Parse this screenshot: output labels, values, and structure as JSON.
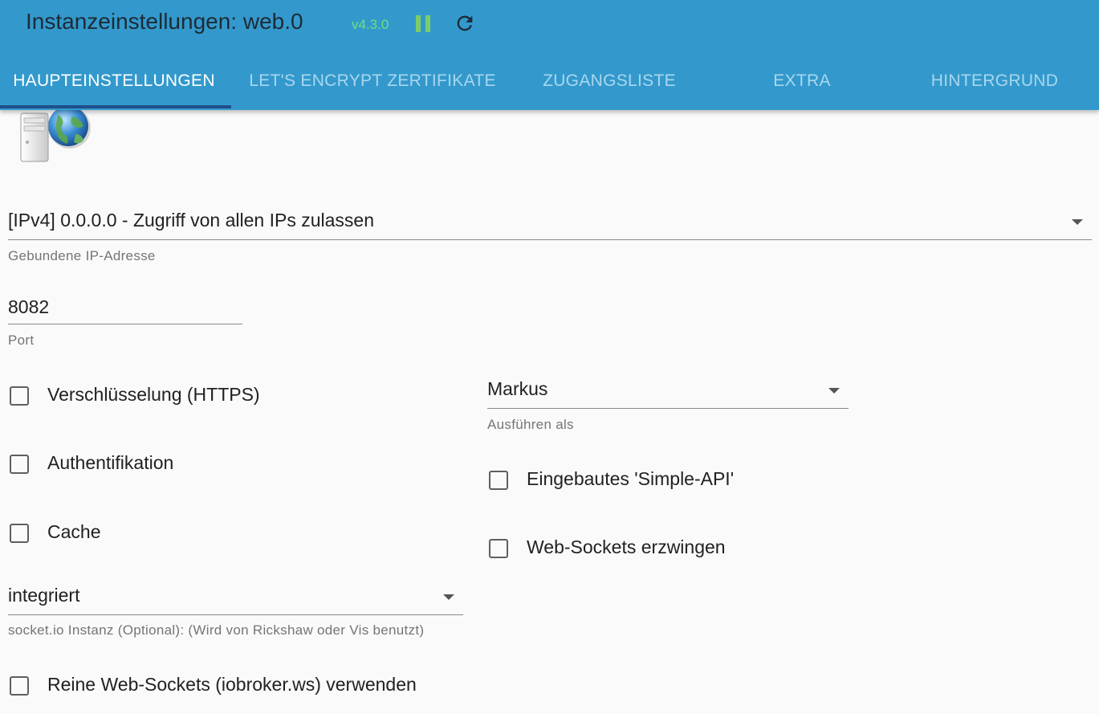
{
  "header": {
    "title": "Instanzeinstellungen: web.0",
    "version": "v4.3.0",
    "colors": {
      "bar": "#3399cc",
      "version": "#6ee07a",
      "pause": "#7ccc6a",
      "tab_indicator": "#1e4f8c"
    },
    "icons": {
      "pause": "pause-icon",
      "refresh": "refresh-icon"
    }
  },
  "tabs": [
    {
      "label": "HAUPTEINSTELLUNGEN",
      "active": true
    },
    {
      "label": "LET'S ENCRYPT ZERTIFIKATE",
      "active": false
    },
    {
      "label": "ZUGANGSLISTE",
      "active": false
    },
    {
      "label": "EXTRA",
      "active": false
    },
    {
      "label": "HINTERGRUND",
      "active": false
    }
  ],
  "main": {
    "logo": "web-server-globe-logo",
    "bind_ip": {
      "value": "[IPv4] 0.0.0.0 - Zugriff von allen IPs zulassen",
      "label": "Gebundene IP-Adresse"
    },
    "port": {
      "value": "8082",
      "label": "Port"
    },
    "run_as": {
      "value": "Markus",
      "label": "Ausführen als"
    },
    "socketio": {
      "value": "integriert",
      "label": "socket.io Instanz (Optional): (Wird von Rickshaw oder Vis benutzt)"
    },
    "checkboxes": {
      "https": {
        "label": "Verschlüsselung (HTTPS)",
        "checked": false
      },
      "auth": {
        "label": "Authentifikation",
        "checked": false
      },
      "cache": {
        "label": "Cache",
        "checked": false
      },
      "simple_api": {
        "label": "Eingebautes 'Simple-API'",
        "checked": false
      },
      "force_ws": {
        "label": "Web-Sockets erzwingen",
        "checked": false
      },
      "pure_ws": {
        "label": "Reine Web-Sockets (iobroker.ws) verwenden",
        "checked": false
      }
    }
  }
}
